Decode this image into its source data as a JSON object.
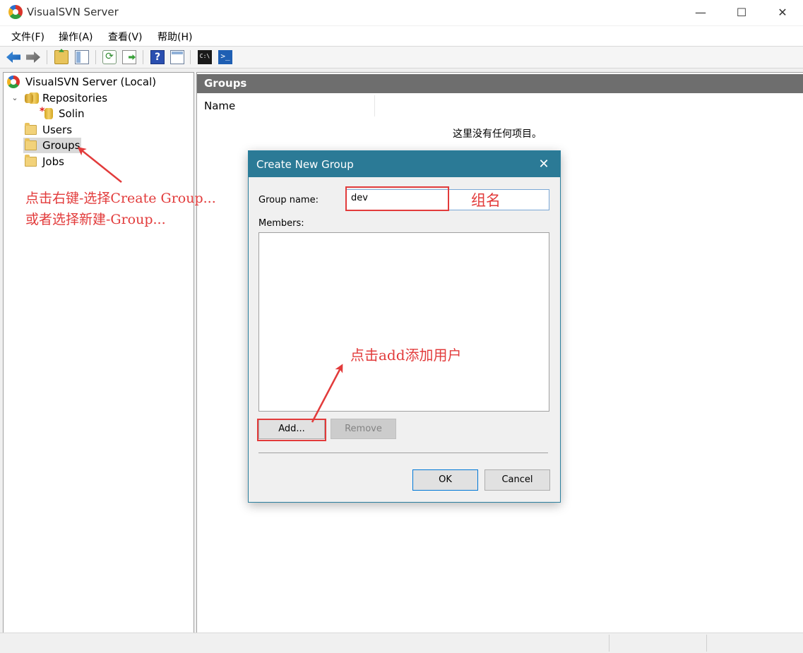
{
  "window": {
    "title": "VisualSVN Server",
    "controls": {
      "minimize": "—",
      "maximize": "☐",
      "close": "✕"
    }
  },
  "menubar": {
    "items": [
      "文件(F)",
      "操作(A)",
      "查看(V)",
      "帮助(H)"
    ]
  },
  "toolbar": {
    "buttons": [
      "back-icon",
      "forward-icon",
      "up-folder-icon",
      "show-hide-tree-icon",
      "refresh-icon",
      "export-list-icon",
      "help-icon",
      "view-icon",
      "command-prompt-icon",
      "powershell-icon"
    ],
    "refresh_glyph": "⟳",
    "help_glyph": "?",
    "cmd_glyph": "C:\\",
    "ps_glyph": ">_"
  },
  "tree": {
    "root": "VisualSVN Server (Local)",
    "repositories": "Repositories",
    "repo_child": "Solin",
    "users": "Users",
    "groups": "Groups",
    "jobs": "Jobs",
    "expand_glyph": "⌄"
  },
  "right_pane": {
    "header": "Groups",
    "column_name": "Name",
    "empty_message": "这里没有任何项目。"
  },
  "dialog": {
    "title": "Create New Group",
    "close_glyph": "✕",
    "group_name_label": "Group name:",
    "group_name_value": "dev",
    "members_label": "Members:",
    "add_button": "Add...",
    "remove_button": "Remove",
    "ok_button": "OK",
    "cancel_button": "Cancel"
  },
  "annotations": {
    "tree_line1": "点击右键-选择Create Group...",
    "tree_line2": "或者选择新建-Group...",
    "group_name_note": "组名",
    "add_note": "点击add添加用户",
    "color": "#e23b3b"
  }
}
